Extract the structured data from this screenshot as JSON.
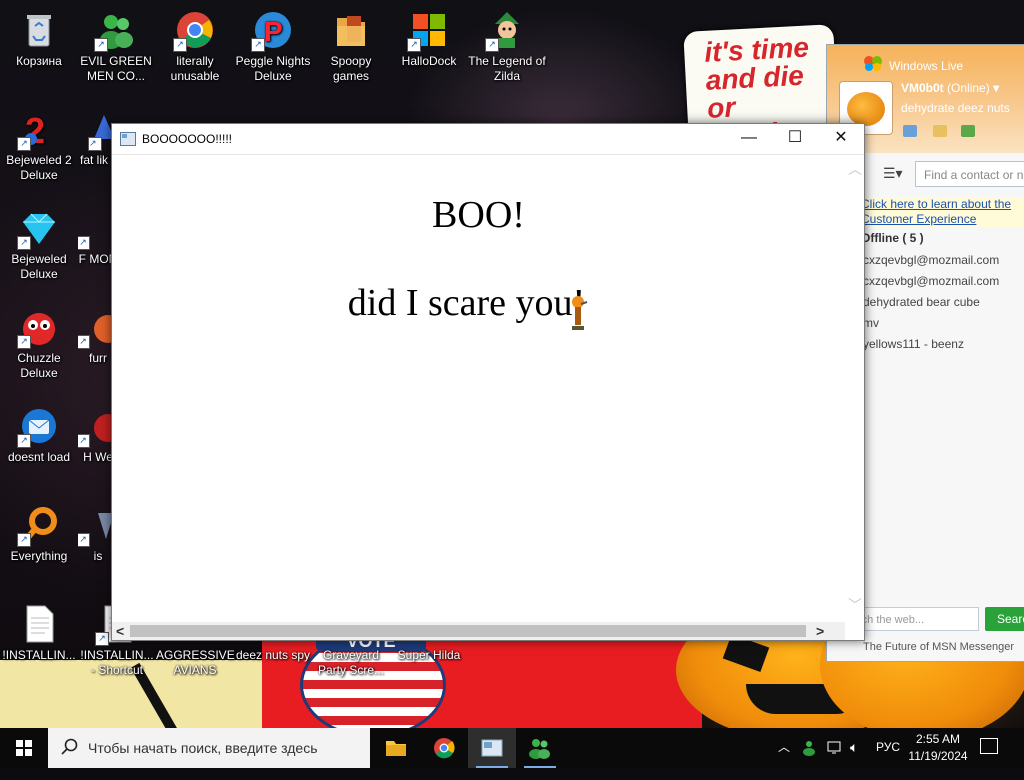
{
  "desktop": {
    "icons": [
      {
        "label": "Корзина"
      },
      {
        "label": "EVIL GREEN MEN CO..."
      },
      {
        "label": "literally unusable"
      },
      {
        "label": "Peggle Nights Deluxe"
      },
      {
        "label": "Spoopy games"
      },
      {
        "label": "HalloDock"
      },
      {
        "label": "The Legend of Zilda"
      },
      {
        "label": "Bejeweled 2 Deluxe"
      },
      {
        "label": "fat lik"
      },
      {
        "label": "Bejeweled Deluxe"
      },
      {
        "label": "F MON"
      },
      {
        "label": "Chuzzle Deluxe"
      },
      {
        "label": "furr"
      },
      {
        "label": "doesnt load"
      },
      {
        "label": "H We"
      },
      {
        "label": "Everything"
      },
      {
        "label": "is"
      },
      {
        "label": "!INSTALLIN..."
      },
      {
        "label": "!INSTALLIN... - Shortcut"
      },
      {
        "label": "AGGRESSIVE AVIANS"
      },
      {
        "label": "deez nuts spy"
      },
      {
        "label": "Graveyard Party Scre..."
      },
      {
        "label": "Super Hilda"
      }
    ],
    "wallpaper_sign": "it's time and die or treating",
    "wallpaper_vote": "VOTE"
  },
  "msn": {
    "title": "Windows Live",
    "username": "VM0b0t",
    "status": "(Online)",
    "personal_message": "dehydrate deez nuts",
    "find_placeholder": "Find a contact or n",
    "learn_link": "Click here to learn about the Customer Experience",
    "offline_header": "Offline ( 5 )",
    "contacts": [
      "cxzqevbgl@mozmail.com",
      "cxzqevbgl@mozmail.com",
      "dehydrated bear cube",
      "mv",
      "yellows111 - beenz"
    ],
    "search_placeholder": "rch the web...",
    "search_button": "Search",
    "footer": "The Future of MSN Messenger"
  },
  "window": {
    "title": "BOOOOOOO!!!!!",
    "line1": "BOO!",
    "line2": "did I scare you!"
  },
  "taskbar": {
    "search_placeholder": "Чтобы начать поиск, введите здесь",
    "language": "РУС",
    "time": "2:55 AM",
    "date": "11/19/2024"
  },
  "colors": {
    "msn_orange": "#f5b25a",
    "taskbar_bg": "#0a0a0a",
    "msn_search_green": "#2aa23a",
    "link_blue": "#1a4fb0"
  }
}
